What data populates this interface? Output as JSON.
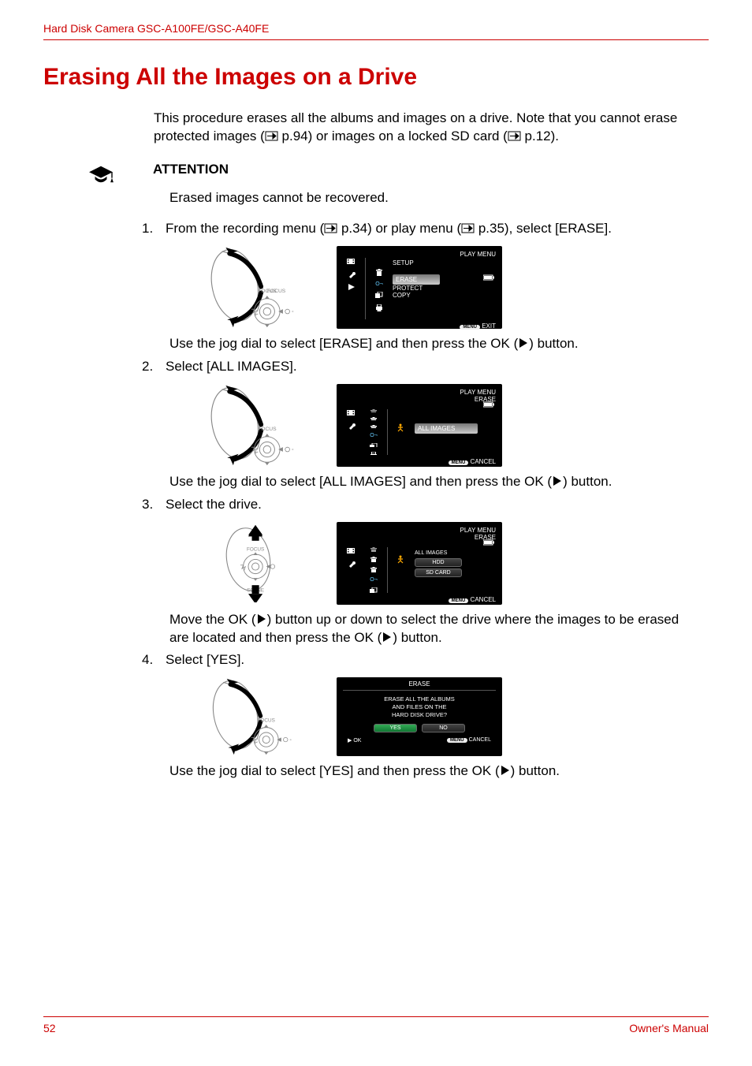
{
  "header": "Hard Disk Camera GSC-A100FE/GSC-A40FE",
  "title": "Erasing All the Images on a Drive",
  "intro": {
    "l1": "This procedure erases all the albums and images on a drive. Note that you cannot erase protected images (",
    "ref1": " p.94",
    "l2": ") or images on a locked SD card (",
    "ref2": " p.12",
    "l3": ")."
  },
  "attention": {
    "label": "ATTENTION",
    "text": "Erased images cannot be recovered."
  },
  "steps": {
    "s1": {
      "num": "1.",
      "a": "From the recording menu (",
      "ref1": " p.34",
      "b": ") or play menu (",
      "ref2": " p.35",
      "c": "), select [ERASE].",
      "sub": "Use the jog dial to select [ERASE] and then press the OK (    ) button."
    },
    "s2": {
      "num": "2.",
      "text": "Select [ALL IMAGES].",
      "sub": "Use the jog dial to select [ALL IMAGES] and then press the OK (    ) button."
    },
    "s3": {
      "num": "3.",
      "text": "Select the drive.",
      "sub": "Move the OK (    ) button up or down to select the drive where the images to be erased are located and then press the OK (    ) button."
    },
    "s4": {
      "num": "4.",
      "text": "Select [YES].",
      "sub": "Use the jog dial to select [YES] and then press the OK (    ) button."
    }
  },
  "dial": {
    "focus": "FOCUS",
    "scene": "SCENE"
  },
  "screens": {
    "s1": {
      "title": "PLAY MENU",
      "items": [
        "SETUP",
        "ERASE",
        "PROTECT",
        "COPY"
      ],
      "exit": "EXIT",
      "menu": "MENU"
    },
    "s2": {
      "title": "PLAY MENU",
      "crumb": "ERASE",
      "item": "ALL IMAGES",
      "cancel": "CANCEL",
      "menu": "MENU"
    },
    "s3": {
      "title": "PLAY MENU",
      "crumb": "ERASE",
      "heading": "ALL IMAGES",
      "opts": [
        "HDD",
        "SD CARD"
      ],
      "cancel": "CANCEL",
      "menu": "MENU"
    },
    "s4": {
      "title": "ERASE",
      "msg": "ERASE ALL THE ALBUMS\nAND FILES ON THE\nHARD DISK DRIVE?",
      "yes": "YES",
      "no": "NO",
      "ok": "OK",
      "cancel": "CANCEL",
      "menu": "MENU"
    }
  },
  "footer": {
    "page": "52",
    "label": "Owner's Manual"
  }
}
